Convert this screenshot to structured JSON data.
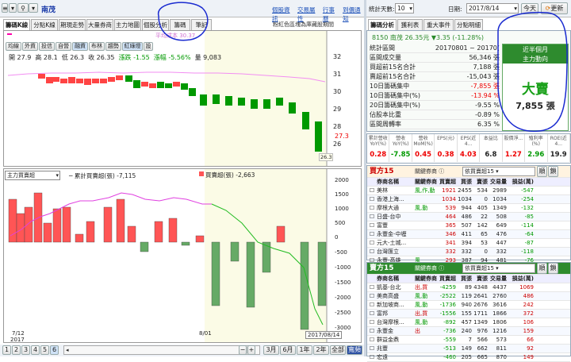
{
  "toolbar": {
    "stock_code": "南茂",
    "links": [
      "個股資訊",
      "交易屬性",
      "行事曆",
      "到價通知"
    ]
  },
  "tabs": [
    {
      "label": "籌碼K線",
      "active": true
    },
    {
      "label": "分點K線"
    },
    {
      "label": "期現走勢"
    },
    {
      "label": "大量券商"
    },
    {
      "label": "主力地圖"
    },
    {
      "label": "個股分析"
    },
    {
      "label": "籌碼"
    },
    {
      "label": "筆記"
    }
  ],
  "chart_hint": "粉紅色區塊為庫藏股期間",
  "avg_cost": "平均成本 30.37",
  "ohlc": {
    "open": "開 27.9",
    "high": "高 28.1",
    "low": "低 26.3",
    "close": "收 26.35",
    "change": "漲跌 -1.55",
    "pct": "漲幅 -5.56%",
    "volume": "量 9,083"
  },
  "ind_buttons": [
    "均線",
    "外資",
    "投信",
    "自營",
    "融資",
    "布林",
    "趨勢",
    "紅綠燈",
    "設"
  ],
  "price_axis": [
    "32",
    "31",
    "30",
    "29",
    "28",
    "27",
    "26"
  ],
  "price_marker": "27.3",
  "price_marker2": "26.3",
  "lower_chart": {
    "selector": "主力買賣超",
    "legend_line": "─ 累計買賣超(張) -7,115",
    "legend_bar": "買賣超(張) -2,663"
  },
  "vol_axis": [
    "2000",
    "1500",
    "1000",
    "500",
    "0",
    "-500",
    "-1000",
    "-1500",
    "-2000",
    "-2500",
    "-3000"
  ],
  "date_axis": {
    "start": "7/12",
    "year": "2017",
    "mid": "8/01",
    "end_box": "2017/08/14"
  },
  "bottom_pages": [
    "1",
    "2",
    "3",
    "4",
    "5",
    "6"
  ],
  "bottom_ranges": [
    "3月",
    "6月",
    "1年",
    "2年",
    "全部",
    "寬頻"
  ],
  "right": {
    "days_label": "統計天數:",
    "days_value": "10",
    "date_label": "日期:",
    "date_value": "2017/8/14",
    "today": "今天",
    "refresh": "更新",
    "tabs": [
      "籌碼分析",
      "獲利表",
      "重大事件",
      "分點明細"
    ],
    "stock_title": "8150 南茂 26.35元 ▼3.35 (-11.28%)",
    "stats": [
      {
        "label": "統計區間",
        "value": "20170801 ~ 20170(",
        "cls": ""
      },
      {
        "label": "區間成交量",
        "value": "56,346 張",
        "cls": ""
      },
      {
        "label": "買超前15名合計",
        "value": "7,188 張",
        "cls": ""
      },
      {
        "label": "賣超前15名合計",
        "value": "-15,043 張",
        "cls": ""
      },
      {
        "label": "10日籌碼集中",
        "value": "-7,855 張",
        "cls": "red"
      },
      {
        "label": "10日籌碼集中(%)",
        "value": "-13.94 %",
        "cls": "red"
      },
      {
        "label": "20日籌碼集中(%)",
        "value": "-9.55 %",
        "cls": ""
      },
      {
        "label": "佔股本比重",
        "value": "-0.89 %",
        "cls": ""
      },
      {
        "label": "區間周轉率",
        "value": "6.35 %",
        "cls": ""
      }
    ],
    "main_force": {
      "title": "近半個月",
      "subtitle": "主力動向",
      "status": "大賣",
      "amount": "7,855 張"
    },
    "eps_headers": [
      "累計營收YoY(%)",
      "營收YoY(%)",
      "營收MoM(%)",
      "EPS(元)",
      "EPS(近4...",
      "本益比",
      "股價淨...",
      "殖利率(%)",
      "ROE(近4..."
    ],
    "eps_values": [
      "0.28",
      "-7.85",
      "0.45",
      "0.38",
      "4.03",
      "6.8",
      "1.27",
      "2.96",
      "19.9"
    ],
    "buy_title": "買方15",
    "buy_dropdown": "依買賣超15",
    "buy_btns": [
      "順",
      "鎖"
    ],
    "table_headers": [
      "券商名稱",
      "關鍵券商",
      "買賣超",
      "買張",
      "賣張",
      "交易量",
      "損益(萬)"
    ],
    "buy_rows": [
      [
        "美林",
        "風,作,動",
        "1921",
        "2455",
        "534",
        "2989",
        "-547"
      ],
      [
        "香港上海...",
        "",
        "1034",
        "1034",
        "0",
        "1034",
        "-254"
      ],
      [
        "摩根大通",
        "風,動",
        "539",
        "944",
        "405",
        "1349",
        "-132"
      ],
      [
        "日盛-台中",
        "",
        "464",
        "486",
        "22",
        "508",
        "-85"
      ],
      [
        "富豐",
        "",
        "365",
        "507",
        "142",
        "649",
        "-114"
      ],
      [
        "永豐金-中壢",
        "",
        "346",
        "411",
        "65",
        "476",
        "-64"
      ],
      [
        "元大-土城...",
        "",
        "341",
        "394",
        "53",
        "447",
        "-87"
      ],
      [
        "台灣匯立",
        "",
        "332",
        "332",
        "0",
        "332",
        "-118"
      ],
      [
        "永豐-高雄",
        "風",
        "293",
        "387",
        "94",
        "481",
        "-76"
      ]
    ],
    "sell_title": "賣方15",
    "sell_dropdown": "依買賣超15",
    "sell_btns": [
      "順",
      "鎖"
    ],
    "sell_rows": [
      [
        "凱基-台北",
        "出,買",
        "-4259",
        "89",
        "4348",
        "4437",
        "1069"
      ],
      [
        "美商高盛",
        "風,動",
        "-2522",
        "119",
        "2641",
        "2760",
        "486"
      ],
      [
        "新加坡商...",
        "風,動",
        "-1736",
        "940",
        "2676",
        "3616",
        "242"
      ],
      [
        "富邦",
        "出,買",
        "-1556",
        "155",
        "1711",
        "1866",
        "372"
      ],
      [
        "台灣摩根...",
        "風,動",
        "-892",
        "457",
        "1349",
        "1806",
        "106"
      ],
      [
        "永豐金",
        "出",
        "-736",
        "240",
        "976",
        "1216",
        "159"
      ],
      [
        "群益金鼎",
        "",
        "-559",
        "7",
        "566",
        "573",
        "66"
      ],
      [
        "兆豐",
        "",
        "-513",
        "149",
        "662",
        "811",
        "92"
      ],
      [
        "宏遠",
        "",
        "-460",
        "205",
        "665",
        "870",
        "149"
      ]
    ]
  }
}
